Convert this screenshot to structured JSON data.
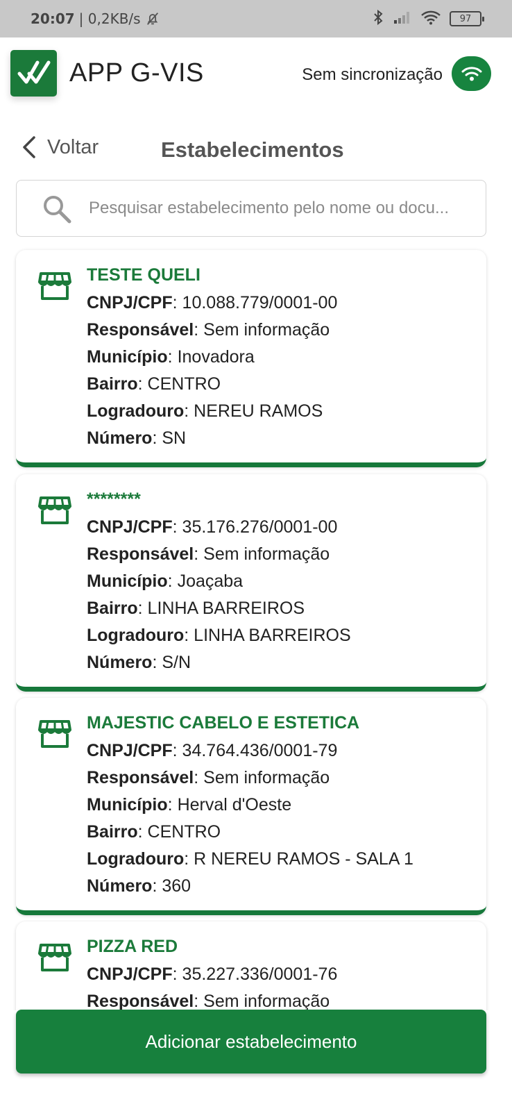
{
  "status_bar": {
    "time": "20:07",
    "network_speed": "| 0,2KB/s",
    "battery": "97"
  },
  "app": {
    "title": "APP G-VIS",
    "sync_status": "Sem sincronização",
    "brand_color": "#1b7a3a"
  },
  "nav": {
    "back_label": "Voltar",
    "page_title": "Estabelecimentos"
  },
  "search": {
    "placeholder": "Pesquisar estabelecimento pelo nome ou docu..."
  },
  "labels": {
    "cnpj": "CNPJ/CPF",
    "responsavel": "Responsável",
    "municipio": "Município",
    "bairro": "Bairro",
    "logradouro": "Logradouro",
    "numero": "Número"
  },
  "establishments": [
    {
      "name": "TESTE QUELI",
      "cnpj": "10.088.779/0001-00",
      "responsavel": "Sem informação",
      "municipio": "Inovadora",
      "bairro": "CENTRO",
      "logradouro": "NEREU RAMOS",
      "numero": "SN"
    },
    {
      "name": "********",
      "cnpj": "35.176.276/0001-00",
      "responsavel": "Sem informação",
      "municipio": "Joaçaba",
      "bairro": "LINHA BARREIROS",
      "logradouro": "LINHA BARREIROS",
      "numero": "S/N"
    },
    {
      "name": "MAJESTIC CABELO E ESTETICA",
      "cnpj": "34.764.436/0001-79",
      "responsavel": "Sem informação",
      "municipio": "Herval d'Oeste",
      "bairro": "CENTRO",
      "logradouro": "R NEREU RAMOS - SALA 1",
      "numero": "360"
    },
    {
      "name": "PIZZA RED",
      "cnpj": "35.227.336/0001-76",
      "responsavel": "Sem informação"
    }
  ],
  "add_button_label": "Adicionar estabelecimento"
}
